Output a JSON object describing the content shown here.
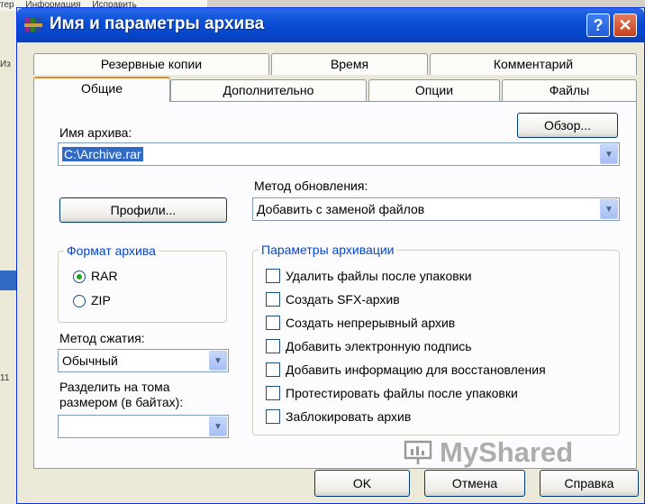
{
  "background": {
    "menu": [
      "тер",
      "Информация",
      "Исправить"
    ],
    "side_labels": [
      "Из",
      "11"
    ]
  },
  "window": {
    "title": "Имя и параметры архива",
    "help_glyph": "?",
    "close_glyph": "✕"
  },
  "tabs_back": [
    "Резервные копии",
    "Время",
    "Комментарий"
  ],
  "tabs_front": [
    "Общие",
    "Дополнительно",
    "Опции",
    "Файлы"
  ],
  "general": {
    "archive_name_label": "Имя архива:",
    "browse_button": "Обзор...",
    "archive_name_value": "C:\\Archive.rar",
    "update_method_label": "Метод обновления:",
    "update_method_value": "Добавить с заменой файлов",
    "profiles_button": "Профили...",
    "format_group_title": "Формат архива",
    "format_rar": "RAR",
    "format_zip": "ZIP",
    "format_selected": "RAR",
    "compression_label": "Метод сжатия:",
    "compression_value": "Обычный",
    "split_label_line1": "Разделить на тома",
    "split_label_line2": "размером (в байтах):",
    "split_value": "",
    "options_group_title": "Параметры архивации",
    "options": [
      {
        "label": "Удалить файлы после упаковки",
        "checked": false
      },
      {
        "label": "Создать SFX-архив",
        "checked": false
      },
      {
        "label": "Создать непрерывный архив",
        "checked": false
      },
      {
        "label": "Добавить электронную подпись",
        "checked": false
      },
      {
        "label": "Добавить информацию для восстановления",
        "checked": false
      },
      {
        "label": "Протестировать файлы после упаковки",
        "checked": false
      },
      {
        "label": "Заблокировать архив",
        "checked": false
      }
    ]
  },
  "footer": {
    "ok_button": "OK",
    "cancel_button": "Отмена",
    "help_button": "Справка"
  },
  "watermark": "MyShared"
}
